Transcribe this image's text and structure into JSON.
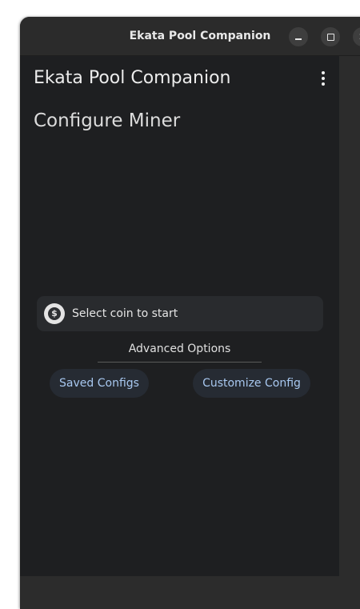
{
  "window": {
    "title": "Ekata Pool Companion"
  },
  "app": {
    "title": "Ekata Pool Companion",
    "menu_icon": "more-vert-icon"
  },
  "page": {
    "heading": "Configure Miner"
  },
  "coin_select": {
    "icon": "dollar-coin-icon",
    "icon_glyph": "$",
    "label": "Select coin to start"
  },
  "advanced_options": {
    "label": "Advanced Options"
  },
  "buttons": {
    "saved_configs": "Saved Configs",
    "customize_config": "Customize Config"
  },
  "colors": {
    "background": "#1e1f21",
    "accent_text": "#a8c8f0",
    "button_bg": "#262b33"
  }
}
